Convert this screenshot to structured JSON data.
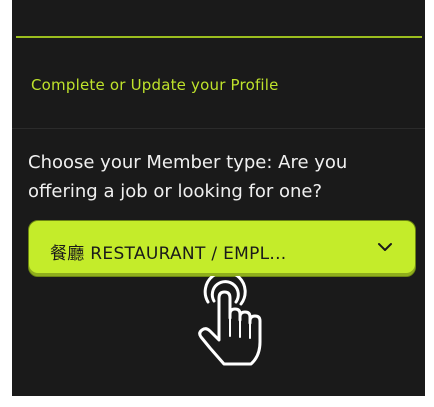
{
  "profile": {
    "heading": "Complete or Update your Profile"
  },
  "member_type": {
    "question": "Choose your Member type: Are you offering a job or looking for one?",
    "selected": "餐廳 RESTAURANT / EMPL..."
  },
  "icons": {
    "dropdown": "chevron-down-icon",
    "cursor": "hand-pointer-icon"
  },
  "colors": {
    "background": "#1a1a1a",
    "accent": "#c4ec2a",
    "accent_text": "#bfe32b",
    "text": "#f0f0f0"
  }
}
